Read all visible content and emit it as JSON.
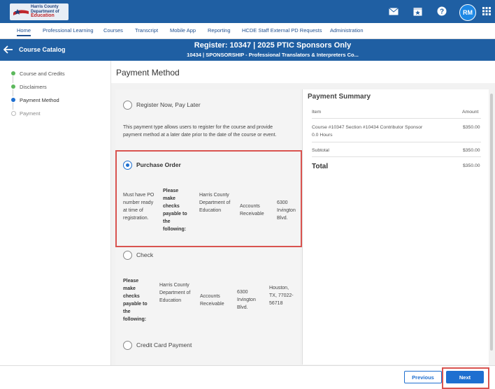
{
  "brand": {
    "org_line1": "Harris County",
    "org_line2": "Department of",
    "org_line3": "Education"
  },
  "header": {
    "icons": [
      "mail-icon",
      "calendar-star-icon",
      "help-icon",
      "apps-grid-icon"
    ],
    "avatar_initials": "RM"
  },
  "nav": {
    "items": [
      "Home",
      "Professional Learning",
      "Courses",
      "Transcript",
      "Mobile App",
      "Reporting",
      "HCDE Staff External PD Requests",
      "Administration"
    ],
    "active": "Home"
  },
  "banner": {
    "back_label": "Course Catalog",
    "title": "Register: 10347 | 2025 PTIC Sponsors Only",
    "subtitle": "10434 | SPONSORSHIP - Professional Translators & Interpreters Co..."
  },
  "steps": [
    {
      "label": "Course and Credits",
      "status": "complete"
    },
    {
      "label": "Disclaimers",
      "status": "complete"
    },
    {
      "label": "Payment Method",
      "status": "current"
    },
    {
      "label": "Payment",
      "status": "pending"
    }
  ],
  "payment": {
    "title": "Payment Method",
    "options": [
      {
        "label": "Register Now, Pay Later",
        "selected": false
      },
      {
        "label": "Purchase Order",
        "selected": true
      },
      {
        "label": "Check",
        "selected": false
      },
      {
        "label": "Credit Card Payment",
        "selected": false
      }
    ],
    "pay_later_desc": "This payment type allows users to register for the course and provide payment method at a later date prior to the date of the course or event.",
    "po": {
      "note": "Must have PO number ready at time of registration.",
      "payable": "Please make checks payable to the following:",
      "org": "Harris County Department of Education",
      "dept": "Accounts Receivable",
      "street": "6300 Irvington Blvd."
    },
    "check": {
      "payable": "Please make checks payable to the following:",
      "org": "Harris County Department of Education",
      "dept": "Accounts Receivable",
      "street": "6300 Irvington Blvd.",
      "city": "Houston, TX, 77022-56718"
    }
  },
  "summary": {
    "title": "Payment Summary",
    "col_item": "Item",
    "col_amount": "Amount",
    "line_item": "Course #10347 Section #10434 Contributor Sponsor",
    "line_hours": "0.0 Hours",
    "line_amount": "$350.00",
    "subtotal_label": "Subtotal",
    "subtotal_amount": "$350.00",
    "total_label": "Total",
    "total_amount": "$350.00"
  },
  "footer": {
    "previous": "Previous",
    "next": "Next"
  },
  "colors": {
    "primary": "#1f5fa3",
    "accent": "#1e6fd0",
    "highlight": "#d9534f",
    "complete": "#5cb85c"
  }
}
